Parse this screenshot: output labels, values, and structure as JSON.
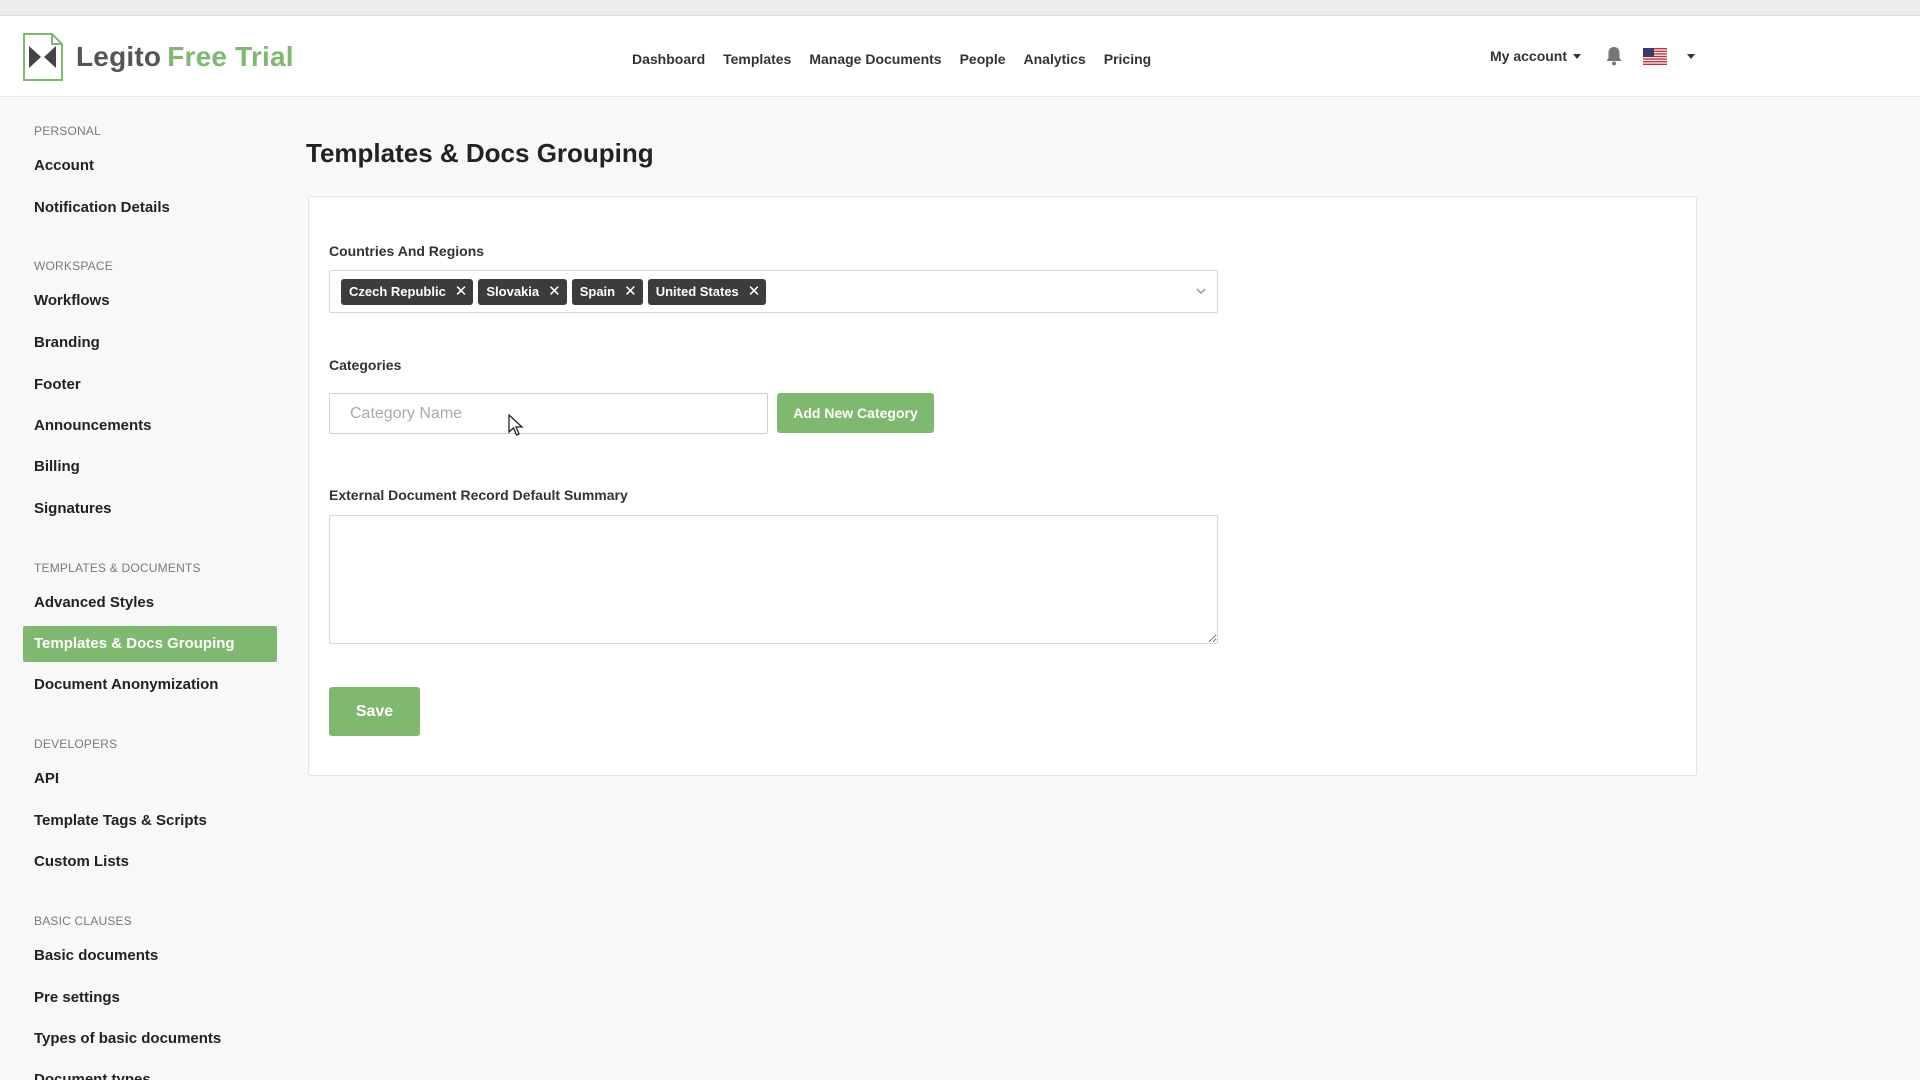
{
  "header": {
    "logo_name": "Legito",
    "logo_suffix": "Free Trial",
    "nav": [
      "Dashboard",
      "Templates",
      "Manage Documents",
      "People",
      "Analytics",
      "Pricing"
    ],
    "account_label": "My account",
    "icons": [
      "bell-icon",
      "us-flag-icon",
      "caret-down-icon"
    ]
  },
  "sidebar": {
    "sections": [
      {
        "title": "PERSONAL",
        "items": [
          "Account",
          "Notification Details"
        ]
      },
      {
        "title": "WORKSPACE",
        "items": [
          "Workflows",
          "Branding",
          "Footer",
          "Announcements",
          "Billing",
          "Signatures"
        ]
      },
      {
        "title": "TEMPLATES & DOCUMENTS",
        "items": [
          "Advanced Styles",
          "Templates & Docs Grouping",
          "Document Anonymization"
        ]
      },
      {
        "title": "DEVELOPERS",
        "items": [
          "API",
          "Template Tags & Scripts",
          "Custom Lists"
        ]
      },
      {
        "title": "BASIC CLAUSES",
        "items": [
          "Basic documents",
          "Pre settings",
          "Types of basic documents",
          "Document types"
        ]
      }
    ],
    "active_item": "Templates & Docs Grouping"
  },
  "main": {
    "title": "Templates & Docs Grouping",
    "countries_label": "Countries And Regions",
    "selected_countries": [
      "Czech Republic",
      "Slovakia",
      "Spain",
      "United States"
    ],
    "categories_label": "Categories",
    "category_placeholder": "Category Name",
    "add_category_label": "Add New Category",
    "summary_label": "External Document Record Default Summary",
    "summary_value": "",
    "save_label": "Save"
  },
  "colors": {
    "accent": "#7fb86f",
    "tag_bg": "#3c3c3c"
  }
}
